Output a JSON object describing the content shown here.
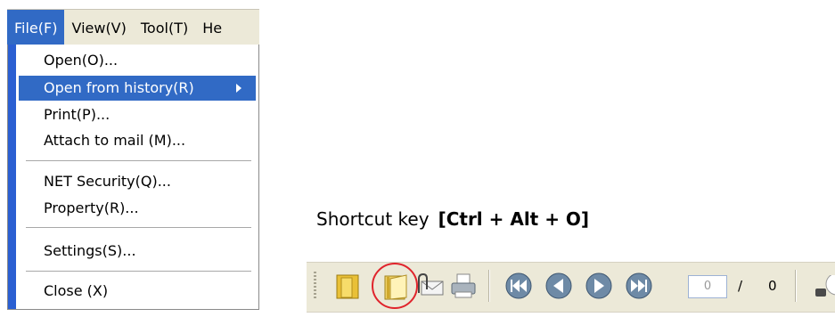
{
  "menubar": {
    "items": [
      "File(F)",
      "View(V)",
      "Tool(T)",
      "He"
    ]
  },
  "file_menu": {
    "items": [
      {
        "label": "Open(O)..."
      },
      {
        "label": "Open from history(R)"
      },
      {
        "label": "Print(P)..."
      },
      {
        "label": "Attach to mail (M)..."
      },
      {
        "label": "NET Security(Q)..."
      },
      {
        "label": "Property(R)..."
      },
      {
        "label": "Settings(S)..."
      },
      {
        "label": "Close (X)"
      }
    ]
  },
  "caption": {
    "prefix": "Shortcut key",
    "keys": "[Ctrl + Alt + O]"
  },
  "toolbar": {
    "buttons": [
      "folder-open-icon",
      "open-from-history-icon",
      "attach-to-mail-icon",
      "print-icon",
      "first-page-icon",
      "previous-page-icon",
      "next-page-icon",
      "last-page-icon"
    ],
    "page_value": "0",
    "page_separator": "/",
    "page_total": "0"
  },
  "colors": {
    "menu_highlight": "#316ac5",
    "menu_left_bar": "#2a5fd2",
    "toolbar_bg": "#ece9d8",
    "highlight_circle": "#e0242c"
  }
}
